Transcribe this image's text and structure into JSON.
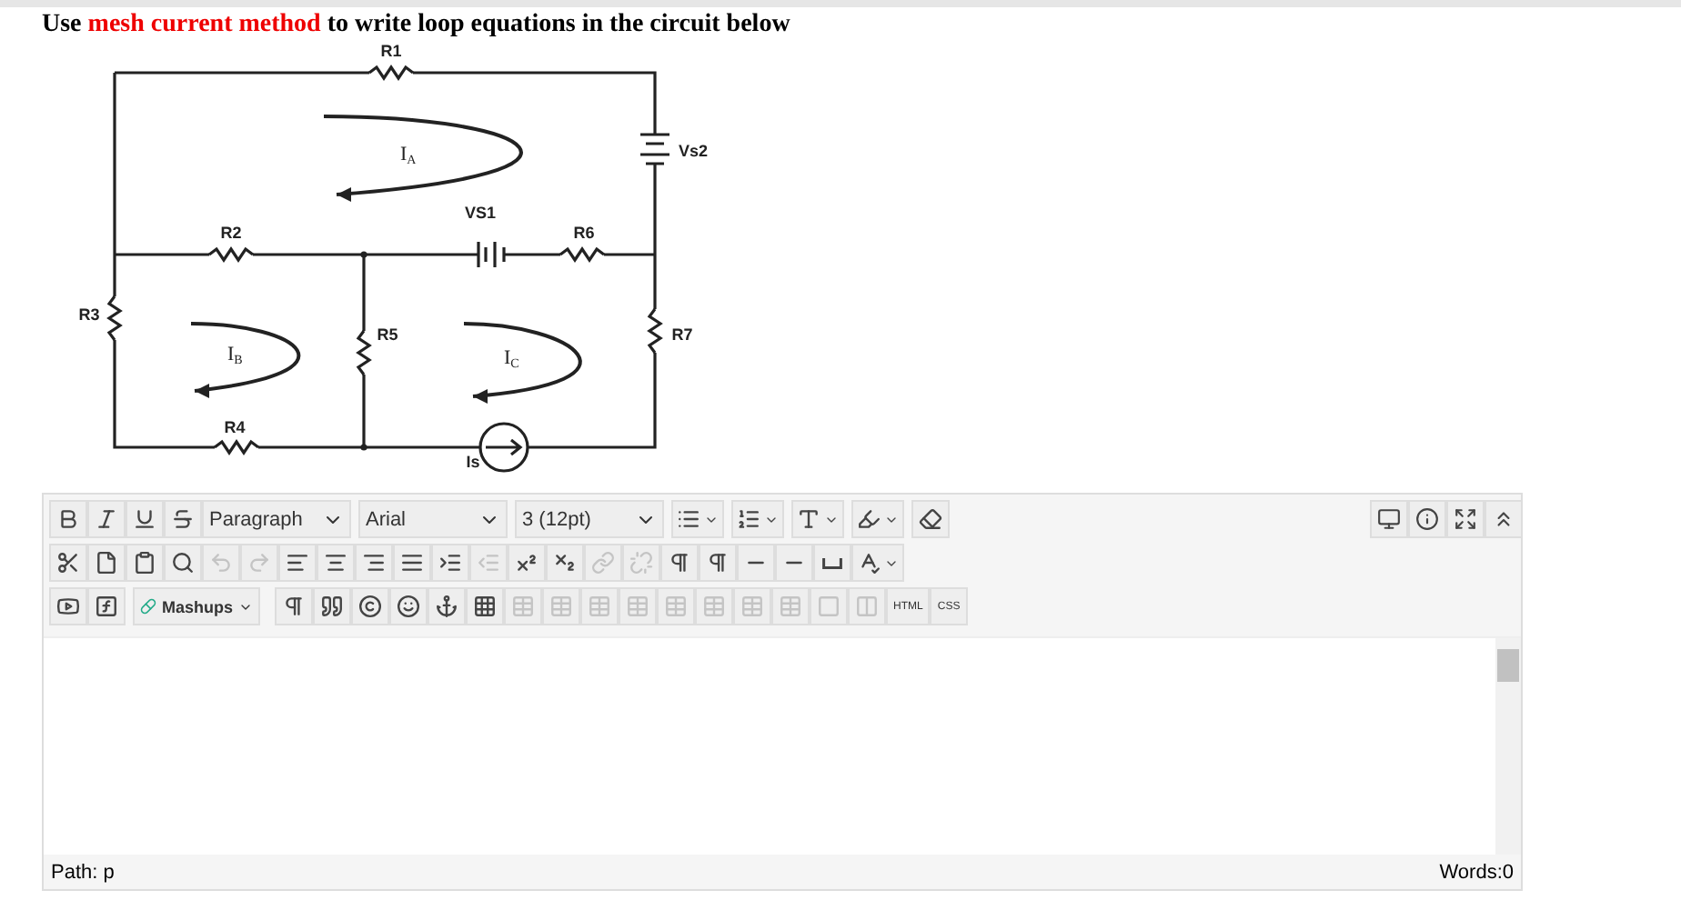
{
  "question": {
    "before": "Use ",
    "highlight": "mesh current method",
    "after": " to write loop equations in the circuit below"
  },
  "circuit": {
    "labels": [
      {
        "text": "R1"
      },
      {
        "text": "Vs2"
      },
      {
        "text": "VS1"
      },
      {
        "text": "R2"
      },
      {
        "text": "R6"
      },
      {
        "text": "R3"
      },
      {
        "text": "R5"
      },
      {
        "text": "R7"
      },
      {
        "text": "R4"
      },
      {
        "text": "Is"
      }
    ],
    "mesh_currents": [
      {
        "text": "I",
        "sub": "A"
      },
      {
        "text": "I",
        "sub": "B"
      },
      {
        "text": "I",
        "sub": "C"
      }
    ]
  },
  "toolbar": {
    "rows": [
      [
        {
          "kind": "button",
          "disabled": false
        },
        {
          "kind": "button",
          "disabled": false
        },
        {
          "kind": "button",
          "disabled": false
        },
        {
          "kind": "button",
          "disabled": false
        },
        {
          "kind": "select",
          "value": "Paragraph"
        },
        {
          "kind": "select",
          "value": "Arial"
        },
        {
          "kind": "select",
          "value": "3 (12pt)"
        },
        {
          "kind": "split",
          "disabled": false
        },
        {
          "kind": "split",
          "disabled": false
        },
        {
          "kind": "split",
          "disabled": false
        },
        {
          "kind": "split",
          "disabled": false
        },
        {
          "kind": "button",
          "disabled": false
        }
      ],
      [
        {
          "kind": "button",
          "disabled": false
        },
        {
          "kind": "button",
          "disabled": false
        },
        {
          "kind": "button",
          "disabled": false
        },
        {
          "kind": "button",
          "disabled": false
        },
        {
          "kind": "button",
          "disabled": true
        },
        {
          "kind": "button",
          "disabled": true
        },
        {
          "kind": "button",
          "disabled": false
        },
        {
          "kind": "button",
          "disabled": false
        },
        {
          "kind": "button",
          "disabled": false
        },
        {
          "kind": "button",
          "disabled": false
        },
        {
          "kind": "button",
          "disabled": false
        },
        {
          "kind": "button",
          "disabled": true
        },
        {
          "kind": "button",
          "disabled": false
        },
        {
          "kind": "button",
          "disabled": false
        },
        {
          "kind": "button",
          "disabled": true
        },
        {
          "kind": "button",
          "disabled": true
        },
        {
          "kind": "button",
          "disabled": false
        },
        {
          "kind": "button",
          "disabled": false
        },
        {
          "kind": "button",
          "disabled": false
        },
        {
          "kind": "button",
          "disabled": false
        },
        {
          "kind": "button",
          "disabled": false
        },
        {
          "kind": "split",
          "disabled": false
        }
      ],
      [
        {
          "kind": "button",
          "disabled": false
        },
        {
          "kind": "button",
          "disabled": false
        },
        {
          "kind": "menu",
          "label": "Mashups"
        },
        {
          "kind": "button",
          "disabled": false
        },
        {
          "kind": "button",
          "disabled": false
        },
        {
          "kind": "button",
          "disabled": false
        },
        {
          "kind": "button",
          "disabled": false
        },
        {
          "kind": "button",
          "disabled": false
        },
        {
          "kind": "button",
          "disabled": false
        },
        {
          "kind": "button",
          "disabled": true
        },
        {
          "kind": "button",
          "disabled": true
        },
        {
          "kind": "button",
          "disabled": true
        },
        {
          "kind": "button",
          "disabled": true
        },
        {
          "kind": "button",
          "disabled": true
        },
        {
          "kind": "button",
          "disabled": true
        },
        {
          "kind": "button",
          "disabled": true
        },
        {
          "kind": "button",
          "disabled": true
        },
        {
          "kind": "button",
          "disabled": true
        },
        {
          "kind": "button",
          "disabled": true
        },
        {
          "kind": "text",
          "label": "HTML"
        },
        {
          "kind": "text",
          "label": "CSS"
        }
      ]
    ]
  },
  "status_bar": {
    "path_label": "Path:",
    "path": "p",
    "words": "Words:0"
  }
}
